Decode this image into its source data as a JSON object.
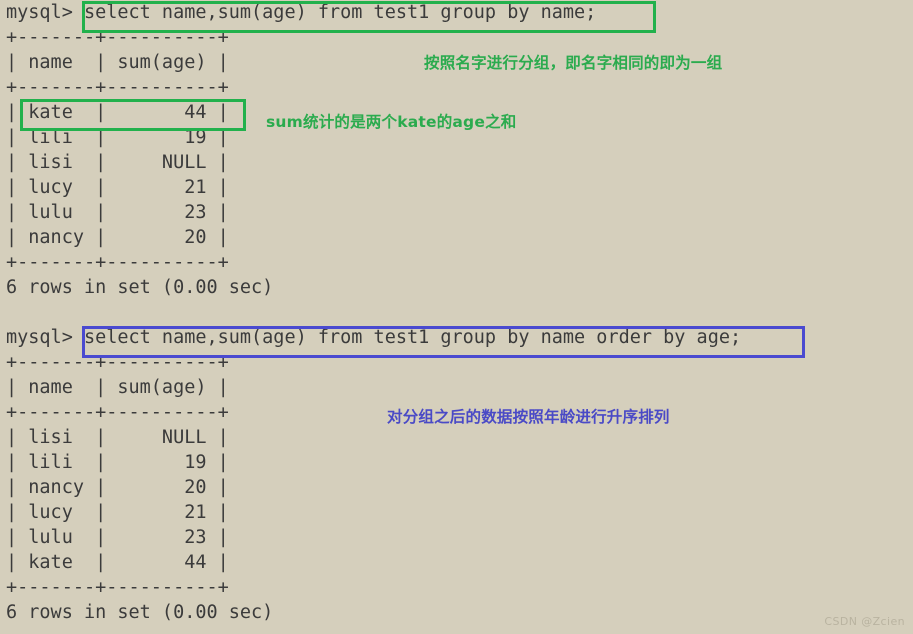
{
  "terminal": {
    "background_color": "#d5cfbc",
    "text_color": "#3b3b3b",
    "lines": [
      "mysql> select name,sum(age) from test1 group by name;",
      "+-------+----------+",
      "| name  | sum(age) |",
      "+-------+----------+",
      "| kate  |       44 |",
      "| lili  |       19 |",
      "| lisi  |     NULL |",
      "| lucy  |       21 |",
      "| lulu  |       23 |",
      "| nancy |       20 |",
      "+-------+----------+",
      "6 rows in set (0.00 sec)",
      "",
      "mysql> select name,sum(age) from test1 group by name order by age;",
      "+-------+----------+",
      "| name  | sum(age) |",
      "+-------+----------+",
      "| lisi  |     NULL |",
      "| lili  |       19 |",
      "| nancy |       20 |",
      "| lucy  |       21 |",
      "| lulu  |       23 |",
      "| kate  |       44 |",
      "+-------+----------+",
      "6 rows in set (0.00 sec)"
    ]
  },
  "query_blocks": [
    {
      "prompt": "mysql>",
      "sql": "select name,sum(age) from test1 group by name;",
      "highlight_color": "#22b14c",
      "columns": [
        "name",
        "sum(age)"
      ],
      "rows": [
        [
          "kate",
          "44"
        ],
        [
          "lili",
          "19"
        ],
        [
          "lisi",
          "NULL"
        ],
        [
          "lucy",
          "21"
        ],
        [
          "lulu",
          "23"
        ],
        [
          "nancy",
          "20"
        ]
      ],
      "status": "6 rows in set (0.00 sec)"
    },
    {
      "prompt": "mysql>",
      "sql": "select name,sum(age) from test1 group by name order by age;",
      "highlight_color": "#4a4ad0",
      "columns": [
        "name",
        "sum(age)"
      ],
      "rows": [
        [
          "lisi",
          "NULL"
        ],
        [
          "lili",
          "19"
        ],
        [
          "nancy",
          "20"
        ],
        [
          "lucy",
          "21"
        ],
        [
          "lulu",
          "23"
        ],
        [
          "kate",
          "44"
        ]
      ],
      "status": "6 rows in set (0.00 sec)"
    }
  ],
  "annotations": [
    {
      "id": "group-by-note",
      "text": "按照名字进行分组，即名字相同的即为一组",
      "color": "#2bab4e"
    },
    {
      "id": "sum-note",
      "text": "sum统计的是两个kate的age之和",
      "color": "#2bab4e"
    },
    {
      "id": "order-by-note",
      "text": "对分组之后的数据按照年龄进行升序排列",
      "color": "#4a4ac6"
    }
  ],
  "watermark": {
    "text": "CSDN @Zcien"
  }
}
